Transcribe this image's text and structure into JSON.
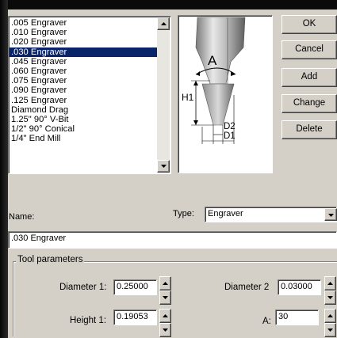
{
  "tools": {
    "items": [
      ".005 Engraver",
      ".010 Engraver",
      ".020 Engraver",
      ".030 Engraver",
      ".045 Engraver",
      ".060 Engraver",
      ".075 Engraver",
      ".090 Engraver",
      ".125 Engraver",
      "Diamond Drag",
      "1.25\" 90° V-Bit",
      "1/2\" 90° Conical",
      "1/4\" End Mill"
    ],
    "selected_index": 3
  },
  "diagram": {
    "angle_label": "A",
    "height_label": "H1",
    "d2_label": "D2",
    "d1_label": "D1"
  },
  "buttons": {
    "ok": "OK",
    "cancel": "Cancel",
    "add": "Add",
    "change": "Change",
    "delete": "Delete"
  },
  "form": {
    "name_label": "Name:",
    "name_value": ".030 Engraver",
    "type_label": "Type:",
    "type_value": "Engraver"
  },
  "tool_parameters": {
    "title": "Tool parameters",
    "diameter1_label": "Diameter 1:",
    "diameter1_value": "0.25000",
    "diameter2_label": "Diameter 2",
    "diameter2_value": "0.03000",
    "height1_label": "Height 1:",
    "height1_value": "0.19053",
    "angle_label": "A:",
    "angle_value": "30"
  }
}
